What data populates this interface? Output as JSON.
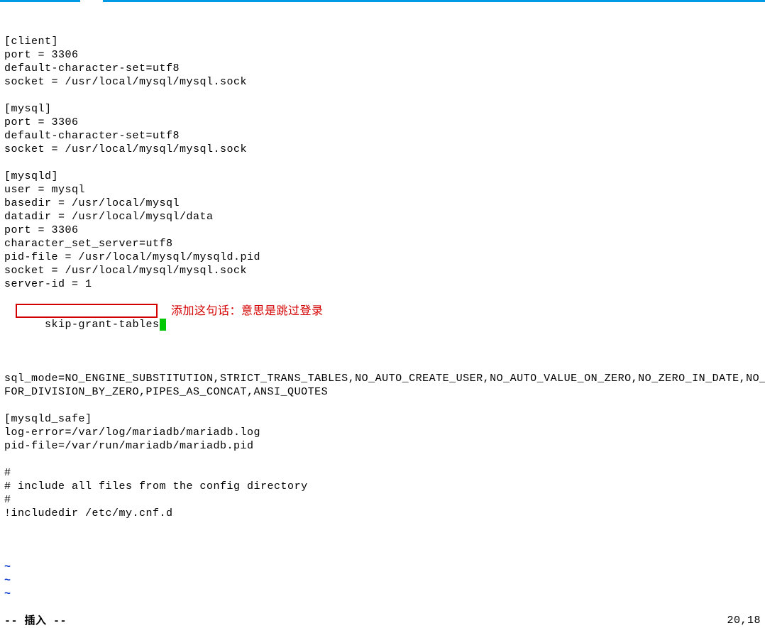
{
  "titlebar": {
    "accent_color": "#0099e5"
  },
  "file": {
    "lines": [
      "[client]",
      "port = 3306",
      "default-character-set=utf8",
      "socket = /usr/local/mysql/mysql.sock",
      "",
      "[mysql]",
      "port = 3306",
      "default-character-set=utf8",
      "socket = /usr/local/mysql/mysql.sock",
      "",
      "[mysqld]",
      "user = mysql",
      "basedir = /usr/local/mysql",
      "datadir = /usr/local/mysql/data",
      "port = 3306",
      "character_set_server=utf8",
      "pid-file = /usr/local/mysql/mysqld.pid",
      "socket = /usr/local/mysql/mysql.sock",
      "server-id = 1"
    ],
    "highlighted_line": "skip-grant-tables",
    "annotation": "添加这句话：意思是跳过登录",
    "lines_after": [
      "",
      "sql_mode=NO_ENGINE_SUBSTITUTION,STRICT_TRANS_TABLES,NO_AUTO_CREATE_USER,NO_AUTO_VALUE_ON_ZERO,NO_ZERO_IN_DATE,NO_ZERO_D",
      "FOR_DIVISION_BY_ZERO,PIPES_AS_CONCAT,ANSI_QUOTES",
      "",
      "[mysqld_safe]",
      "log-error=/var/log/mariadb/mariadb.log",
      "pid-file=/var/run/mariadb/mariadb.pid",
      "",
      "#",
      "# include all files from the config directory",
      "#",
      "!includedir /etc/my.cnf.d",
      ""
    ],
    "tildes": [
      "~",
      "~",
      "~"
    ]
  },
  "status": {
    "mode_prefix": "-- ",
    "mode_cjk": "插入",
    "mode_suffix": " --",
    "position": "20,18"
  }
}
